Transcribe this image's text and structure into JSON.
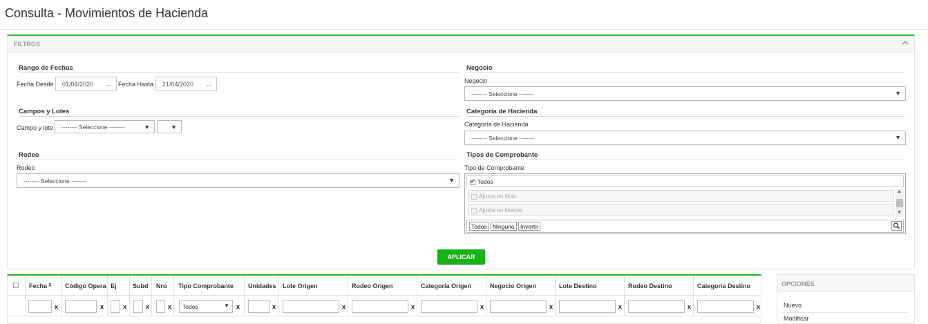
{
  "page": {
    "title": "Consulta - Movimientos de Hacienda"
  },
  "filters": {
    "title": "FILTROS",
    "date_range": {
      "section": "Rango de Fechas",
      "from_label": "Fecha Desde",
      "from_value": "01/04/2020",
      "to_label": "Fecha Hasta",
      "to_value": "21/04/2020",
      "picker_label": "..."
    },
    "fields_lots": {
      "section": "Campos y Lotes",
      "label": "Campo y lote",
      "select_value": "-------- Seleccione --------",
      "select2_value": ""
    },
    "rodeo": {
      "section": "Rodeo",
      "label": "Rodeo",
      "select_value": "-------- Seleccione --------"
    },
    "business": {
      "section": "Negocio",
      "label": "Negocio",
      "select_value": "-------- Seleccione --------"
    },
    "category": {
      "section": "Categoría de Hacienda",
      "label": "Categoría de Hacienda",
      "select_value": "-------- Seleccione --------"
    },
    "voucher_types": {
      "section": "Tipos de Comprobante",
      "label": "Tipo de Comprobante",
      "all_option": "Todos",
      "options": [
        "Ajuste en Mas",
        "Ajuste en Menos"
      ],
      "buttons": [
        "Todos",
        "Ninguno",
        "Invertir"
      ]
    },
    "apply_label": "APLICAR"
  },
  "grid": {
    "columns": [
      "Fecha",
      "Código Opera",
      "Ej",
      "Subd",
      "Nro",
      "Tipo Comprobante",
      "Unidades",
      "Lote Origen",
      "Rodeo Origen",
      "Categoría Origen",
      "Negocio Origen",
      "Lote Destino",
      "Rodeo Destino",
      "Categoría Destino"
    ],
    "tipo_filter_value": "Todos",
    "clear_label": "x"
  },
  "options": {
    "title": "OPCIONES",
    "items": [
      "Nuevo",
      "Modificar"
    ]
  },
  "icons": {
    "collapse": "chevron-up-icon",
    "dropdown": "caret-down-icon",
    "search": "search-icon",
    "sort": "sort-icon"
  },
  "colors": {
    "accent": "#21b821",
    "apply_bg": "#16b216"
  }
}
